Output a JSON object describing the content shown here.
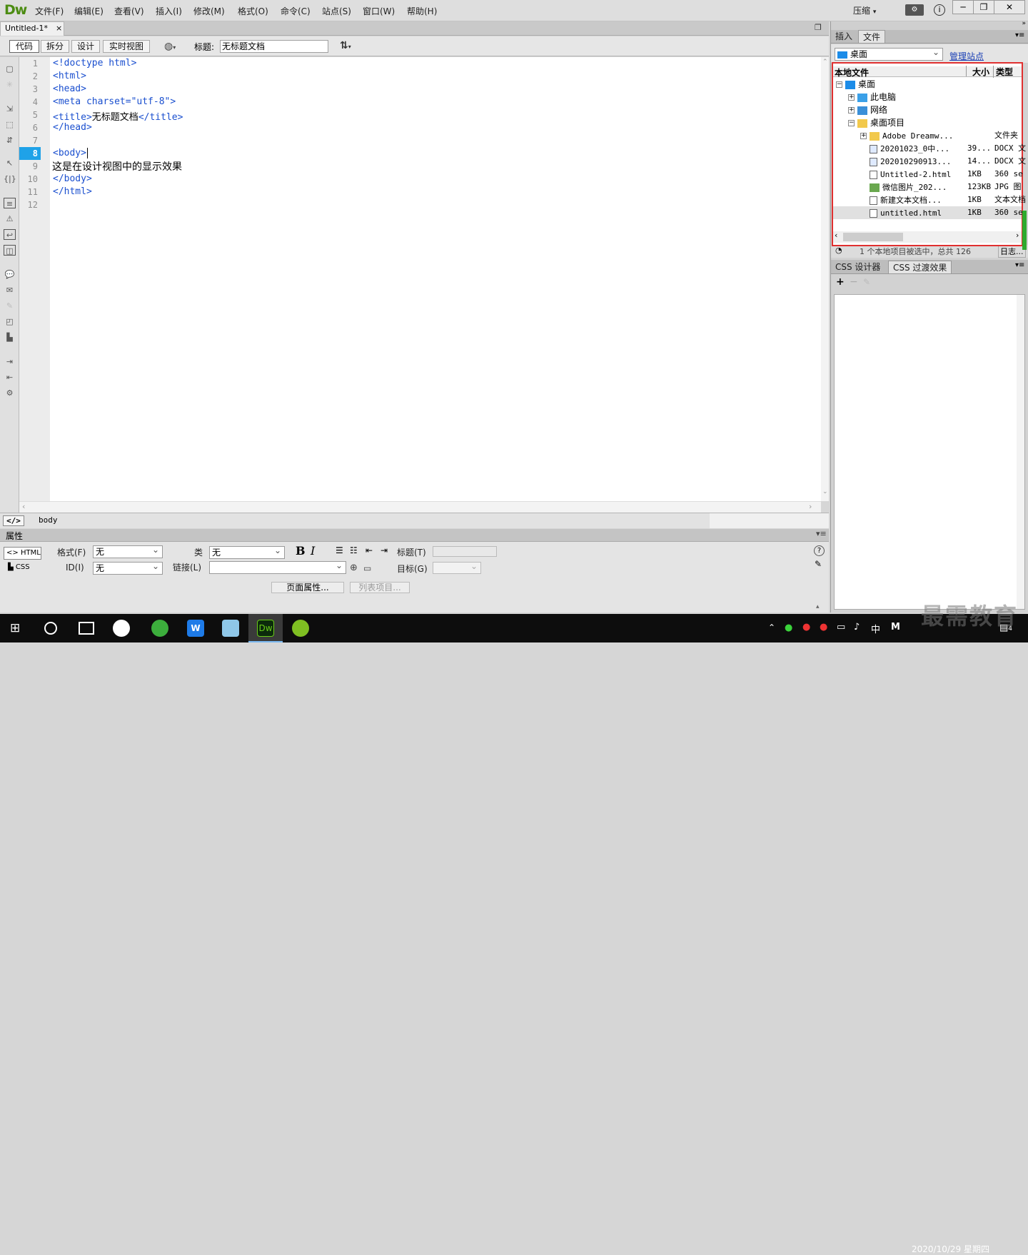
{
  "app": {
    "logo": "Dw",
    "compress": "压缩"
  },
  "menu": [
    "文件(F)",
    "编辑(E)",
    "查看(V)",
    "插入(I)",
    "修改(M)",
    "格式(O)",
    "命令(C)",
    "站点(S)",
    "窗口(W)",
    "帮助(H)"
  ],
  "document_tab": {
    "label": "Untitled-1*",
    "close": "×"
  },
  "view_buttons": [
    "代码",
    "拆分",
    "设计",
    "实时视图"
  ],
  "title_field": {
    "label": "标题:",
    "value": "无标题文档"
  },
  "code": {
    "line_numbers": [
      "1",
      "2",
      "3",
      "4",
      "5",
      "6",
      "7",
      "8",
      "9",
      "10",
      "11",
      "12"
    ],
    "current_line": "8",
    "lines": [
      {
        "tag": "<!doctype html>",
        "text": ""
      },
      {
        "tag": "<html>",
        "text": ""
      },
      {
        "tag": "<head>",
        "text": ""
      },
      {
        "tag": "<meta charset=\"utf-8\">",
        "text": ""
      },
      {
        "tag": "<title>",
        "text": "无标题文档",
        "tail": "</title>"
      },
      {
        "tag": "</head>",
        "text": ""
      },
      {
        "tag": "",
        "text": ""
      },
      {
        "tag": "<body>",
        "text": ""
      },
      {
        "tag": "",
        "text": "这是在设计视图中的显示效果"
      },
      {
        "tag": "</body>",
        "text": ""
      },
      {
        "tag": "</html>",
        "text": ""
      },
      {
        "tag": "",
        "text": ""
      }
    ]
  },
  "tag_selector": {
    "button": "</>",
    "tag": "body"
  },
  "properties": {
    "header": "属性",
    "html_btn": "HTML",
    "css_btn": "CSS",
    "format_label": "格式(F)",
    "format_value": "无",
    "id_label": "ID(I)",
    "id_value": "无",
    "class_label": "类",
    "class_value": "无",
    "link_label": "链接(L)",
    "link_value": "",
    "bold": "B",
    "italic": "I",
    "title_label": "标题(T)",
    "target_label": "目标(G)",
    "page_props_btn": "页面属性...",
    "list_item_btn": "列表项目..."
  },
  "right_panel": {
    "tabs": [
      "插入",
      "文件"
    ],
    "location": "桌面",
    "manage_site": "管理站点",
    "columns": {
      "local": "本地文件",
      "size": "大小",
      "type": "类型"
    },
    "tree": [
      {
        "indent": 0,
        "expander": "⊟",
        "name": "桌面",
        "size": "",
        "type": "",
        "icon": "desktop"
      },
      {
        "indent": 1,
        "expander": "⊞",
        "name": "此电脑",
        "size": "",
        "type": "",
        "icon": "computer"
      },
      {
        "indent": 1,
        "expander": "⊞",
        "name": "网络",
        "size": "",
        "type": "",
        "icon": "network"
      },
      {
        "indent": 1,
        "expander": "⊟",
        "name": "桌面项目",
        "size": "",
        "type": "",
        "icon": "folder"
      },
      {
        "indent": 2,
        "expander": "⊞",
        "name": "Adobe Dreamw...",
        "size": "",
        "type": "文件夹",
        "icon": "folder"
      },
      {
        "indent": 2,
        "expander": "",
        "name": "20201023_0中...",
        "size": "39...",
        "type": "DOCX 文",
        "icon": "docx"
      },
      {
        "indent": 2,
        "expander": "",
        "name": "202010290913...",
        "size": "14...",
        "type": "DOCX 文",
        "icon": "docx"
      },
      {
        "indent": 2,
        "expander": "",
        "name": "Untitled-2.html",
        "size": "1KB",
        "type": "360 se",
        "icon": "html"
      },
      {
        "indent": 2,
        "expander": "",
        "name": "微信图片_202...",
        "size": "123KB",
        "type": "JPG 图",
        "icon": "image"
      },
      {
        "indent": 2,
        "expander": "",
        "name": "新建文本文档...",
        "size": "1KB",
        "type": "文本文档",
        "icon": "text"
      },
      {
        "indent": 2,
        "expander": "",
        "name": "untitled.html",
        "size": "1KB",
        "type": "360 se",
        "icon": "html",
        "selected": true
      }
    ],
    "status": "1 个本地项目被选中，总共 126",
    "log_btn": "日志...",
    "css_tabs": [
      "CSS 设计器",
      "CSS 过渡效果"
    ]
  },
  "taskbar": {
    "ime": "中",
    "date": "2020/10/29 星期四",
    "notif_count": "4"
  },
  "watermark": "最需教育"
}
